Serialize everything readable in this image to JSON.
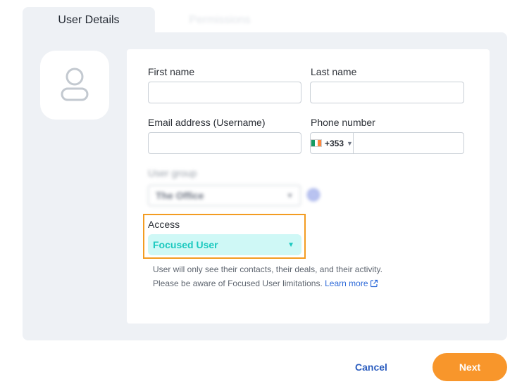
{
  "tabs": {
    "user_details": "User Details",
    "permissions": "Permissions"
  },
  "form": {
    "first_name": {
      "label": "First name",
      "value": ""
    },
    "last_name": {
      "label": "Last name",
      "value": ""
    },
    "email": {
      "label": "Email address (Username)",
      "value": ""
    },
    "phone": {
      "label": "Phone number",
      "country_code": "+353",
      "country_flag": "ireland-flag",
      "value": ""
    },
    "user_group": {
      "label": "User group",
      "value": "The Office"
    },
    "access": {
      "label": "Access",
      "value": "Focused User",
      "help_line1": "User will only see their contacts, their deals, and their activity.",
      "help_line2": "Please be aware of Focused User limitations.",
      "learn_more": "Learn more"
    }
  },
  "actions": {
    "cancel": "Cancel",
    "next": "Next"
  },
  "colors": {
    "accent_orange": "#f8962b",
    "highlight_border": "#f39c21",
    "access_text": "#1cc9bf",
    "access_bg": "#cff8f6",
    "link_blue": "#2f6bd9",
    "panel_bg": "#eef1f5"
  }
}
